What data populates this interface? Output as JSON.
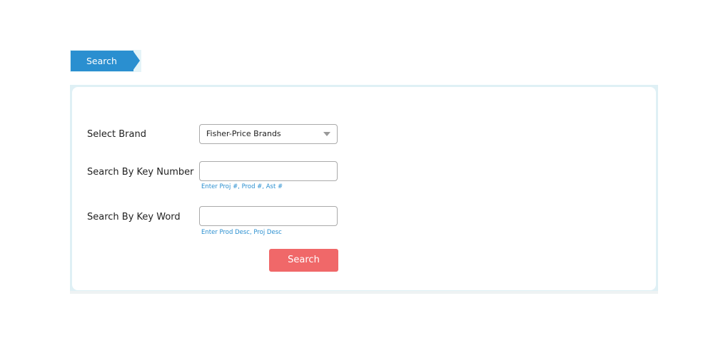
{
  "tab": {
    "label": "Search"
  },
  "form": {
    "brand": {
      "label": "Select Brand",
      "selected": "Fisher-Price Brands"
    },
    "key_number": {
      "label": "Search By Key Number",
      "value": "",
      "placeholder": "",
      "hint": "Enter Proj #, Prod #, Ast #"
    },
    "key_word": {
      "label": "Search By Key Word",
      "value": "",
      "placeholder": "",
      "hint": "Enter Prod Desc, Proj Desc"
    },
    "submit_label": "Search"
  },
  "icons": {
    "select_caret": "chevron-down-icon"
  },
  "colors": {
    "tab_background": "#2a8fd0",
    "hint_text": "#2a8fd0",
    "button_background": "#f06869",
    "panel_border": "#dff0f5"
  }
}
